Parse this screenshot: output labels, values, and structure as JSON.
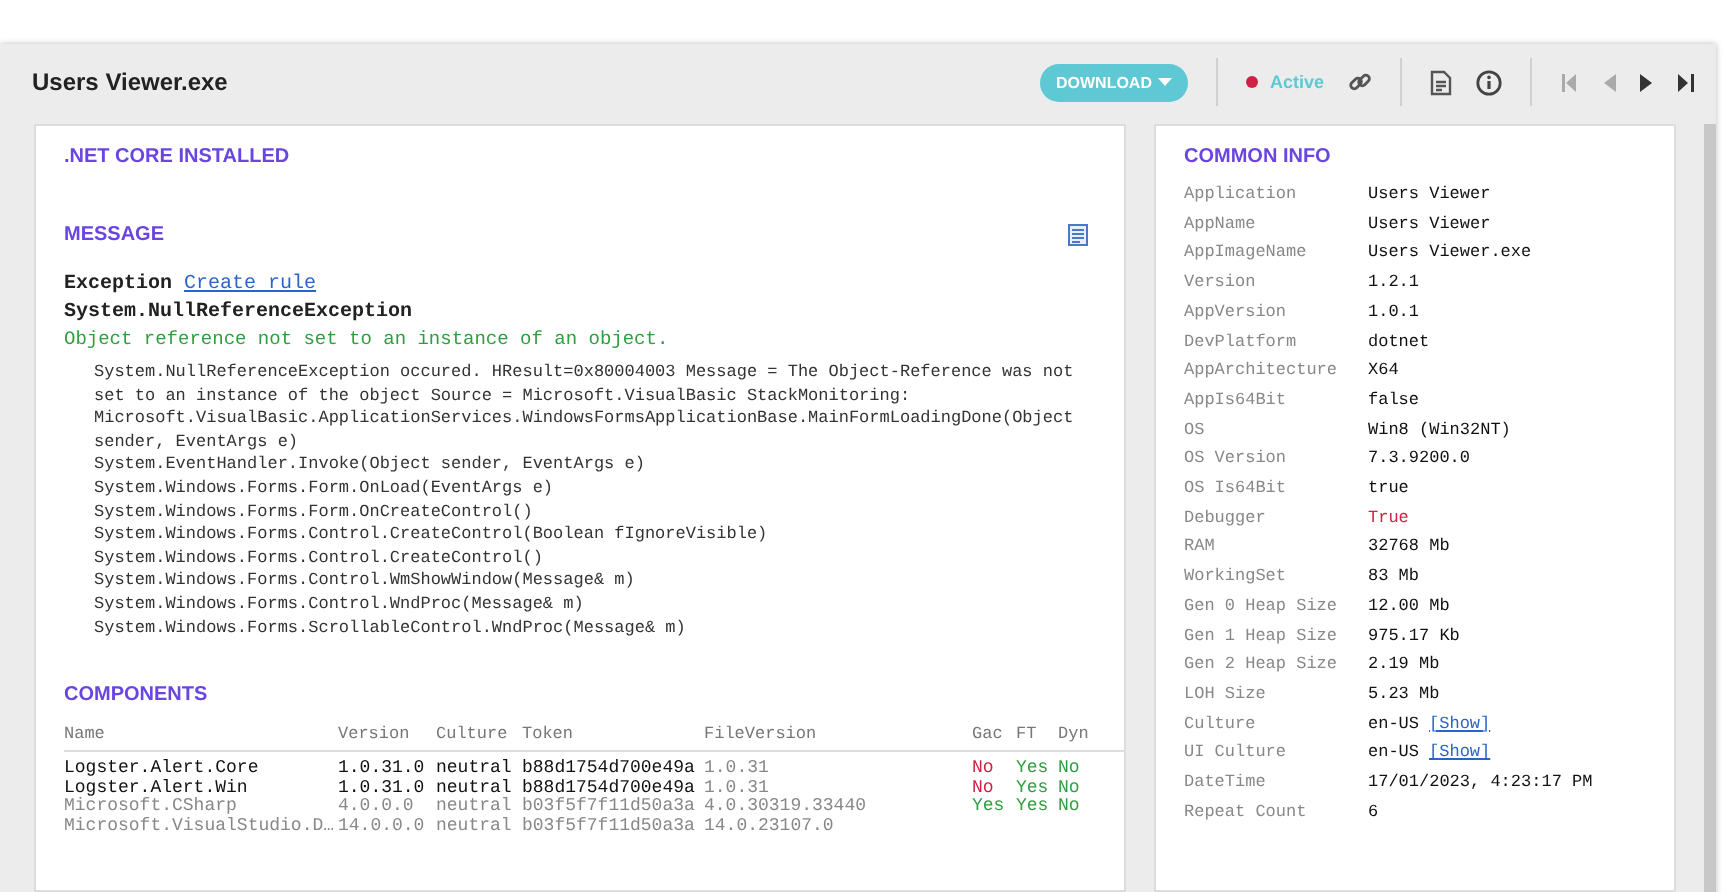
{
  "window": {
    "title": "Users Viewer.exe"
  },
  "toolbar": {
    "download": "DOWNLOAD",
    "status": {
      "label": "Active",
      "color": "#cc2244"
    }
  },
  "main": {
    "net_core": {
      "heading": ".NET CORE INSTALLED"
    },
    "message": {
      "heading": "MESSAGE",
      "exception_label": "Exception",
      "create_rule": "Create rule",
      "exception_type": "System.NullReferenceException",
      "summary": "Object reference not set to an instance of an object.",
      "stack": [
        "System.NullReferenceException occured. HResult=0x80004003 Message = The Object-Reference was not set to an instance of the object Source = Microsoft.VisualBasic StackMonitoring: Microsoft.VisualBasic.ApplicationServices.WindowsFormsApplicationBase.MainFormLoadingDone(Object sender, EventArgs e)",
        "System.EventHandler.Invoke(Object sender, EventArgs e)",
        "System.Windows.Forms.Form.OnLoad(EventArgs e)",
        "System.Windows.Forms.Form.OnCreateControl()",
        "System.Windows.Forms.Control.CreateControl(Boolean fIgnoreVisible)",
        "System.Windows.Forms.Control.CreateControl()",
        "System.Windows.Forms.Control.WmShowWindow(Message& m)",
        "System.Windows.Forms.Control.WndProc(Message& m)",
        "System.Windows.Forms.ScrollableControl.WndProc(Message& m)"
      ]
    },
    "components": {
      "heading": "COMPONENTS",
      "columns": [
        "Name",
        "Version",
        "Culture",
        "Token",
        "FileVersion",
        "Gac",
        "FT",
        "Dyn"
      ],
      "rows": [
        {
          "highlighted": true,
          "name": "Logster.Alert.Core",
          "version": "1.0.31.0",
          "culture": "neutral",
          "token": "b88d1754d700e49a",
          "file_version": "1.0.31",
          "flags": [
            {
              "text": "No",
              "color": "#cc2244"
            },
            {
              "text": "Yes",
              "color": "#2e9e3e"
            },
            {
              "text": "No",
              "color": "#2e9e3e"
            }
          ]
        },
        {
          "highlighted": true,
          "name": "Logster.Alert.Win",
          "version": "1.0.31.0",
          "culture": "neutral",
          "token": "b88d1754d700e49a",
          "file_version": "1.0.31",
          "flags": [
            {
              "text": "No",
              "color": "#cc2244"
            },
            {
              "text": "Yes",
              "color": "#2e9e3e"
            },
            {
              "text": "No",
              "color": "#2e9e3e"
            }
          ]
        },
        {
          "highlighted": false,
          "name": "Microsoft.CSharp",
          "version": "4.0.0.0",
          "culture": "neutral",
          "token": "b03f5f7f11d50a3a",
          "file_version": "4.0.30319.33440",
          "flags": [
            {
              "text": "Yes",
              "color": "#2e9e3e"
            },
            {
              "text": "Yes",
              "color": "#2e9e3e"
            },
            {
              "text": "No",
              "color": "#2e9e3e"
            }
          ]
        },
        {
          "highlighted": false,
          "name": "Microsoft.VisualStudio.D…",
          "version": "14.0.0.0",
          "culture": "neutral",
          "token": "b03f5f7f11d50a3a",
          "file_version": "14.0.23107.0",
          "flags": []
        }
      ]
    }
  },
  "common_info": {
    "heading": "COMMON INFO",
    "rows": [
      {
        "label": "Application",
        "value": "Users Viewer",
        "warning": false
      },
      {
        "label": "AppName",
        "value": "Users Viewer",
        "warning": false
      },
      {
        "label": "AppImageName",
        "value": "Users Viewer.exe",
        "warning": false
      },
      {
        "label": "Version",
        "value": "1.2.1",
        "warning": false
      },
      {
        "label": "AppVersion",
        "value": "1.0.1",
        "warning": false
      },
      {
        "label": "DevPlatform",
        "value": "dotnet",
        "warning": false
      },
      {
        "label": "AppArchitecture",
        "value": "X64",
        "warning": false
      },
      {
        "label": "AppIs64Bit",
        "value": "false",
        "warning": false
      },
      {
        "label": "OS",
        "value": "Win8 (Win32NT)",
        "warning": false
      },
      {
        "label": "OS Version",
        "value": "7.3.9200.0",
        "warning": false
      },
      {
        "label": "OS Is64Bit",
        "value": "true",
        "warning": false
      },
      {
        "label": "Debugger",
        "value": "True",
        "warning": true
      },
      {
        "label": "RAM",
        "value": "32768 Mb",
        "warning": false
      },
      {
        "label": "WorkingSet",
        "value": "83 Mb",
        "warning": false
      },
      {
        "label": "Gen 0 Heap Size",
        "value": "12.00 Mb",
        "warning": false
      },
      {
        "label": "Gen 1 Heap Size",
        "value": "975.17 Kb",
        "warning": false
      },
      {
        "label": "Gen 2 Heap Size",
        "value": "2.19 Mb",
        "warning": false
      },
      {
        "label": "LOH Size",
        "value": "5.23 Mb",
        "warning": false
      },
      {
        "label": "Culture",
        "value": "en-US",
        "link": "[Show]",
        "warning": false
      },
      {
        "label": "UI Culture",
        "value": "en-US",
        "link": "[Show]",
        "warning": false
      },
      {
        "label": "DateTime",
        "value": "17/01/2023, 4:23:17 PM",
        "warning": false
      },
      {
        "label": "Repeat Count",
        "value": "6",
        "warning": false
      }
    ]
  }
}
